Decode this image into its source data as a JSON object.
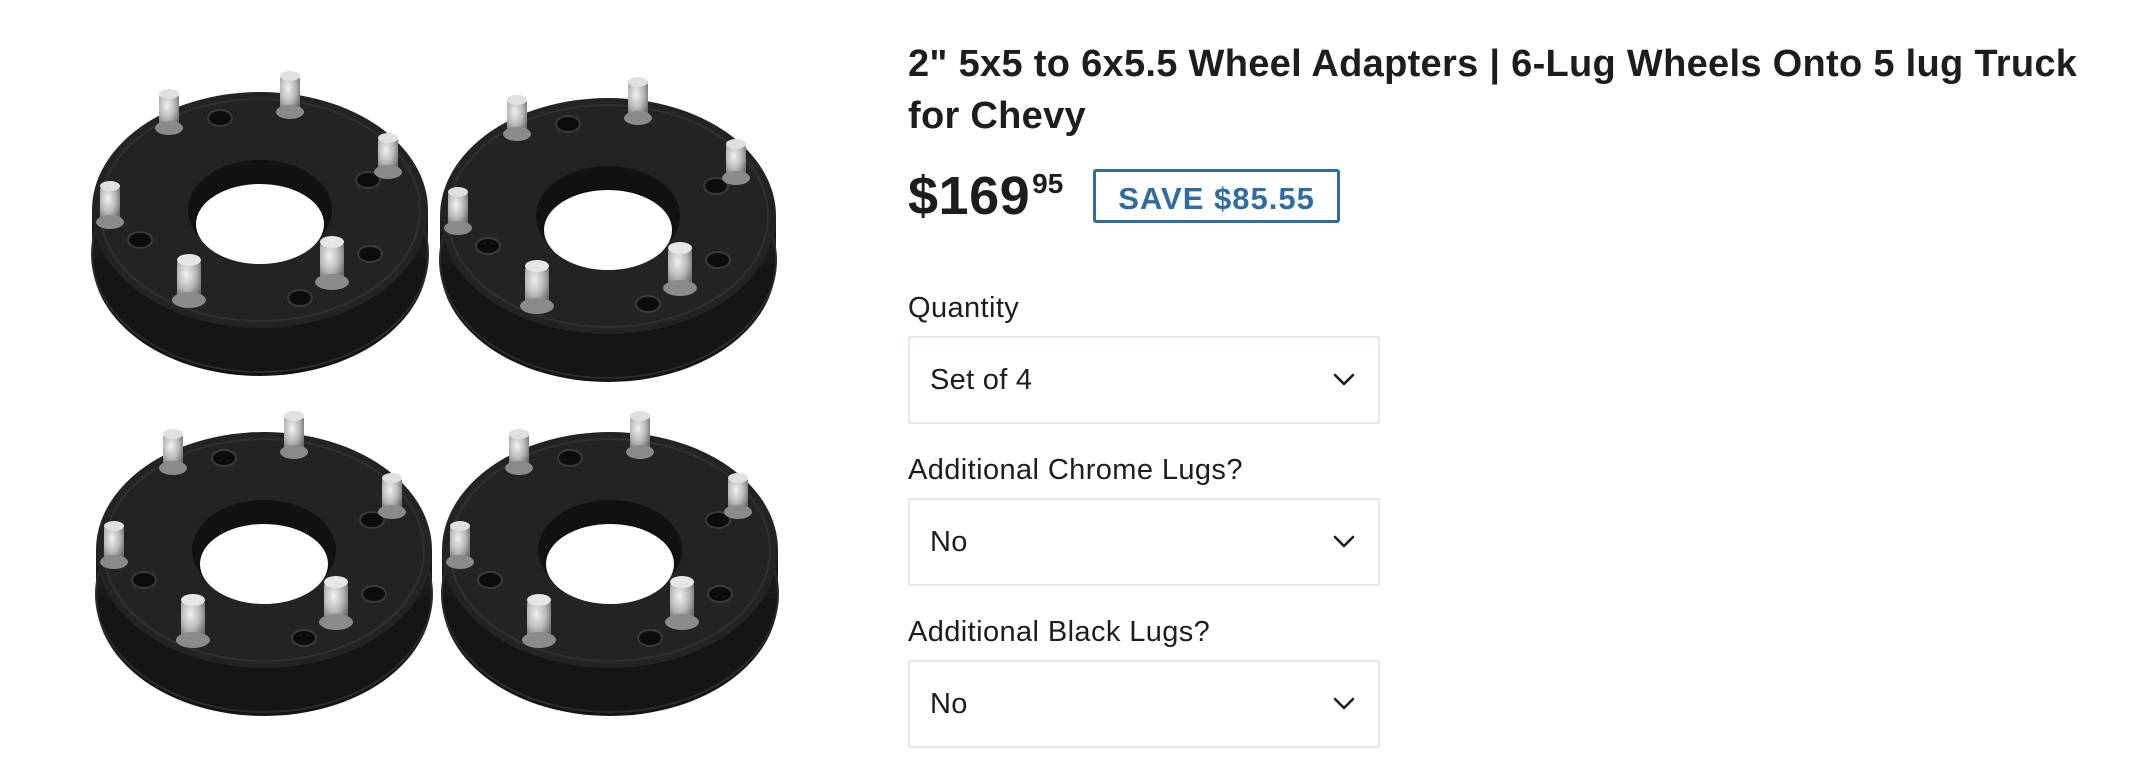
{
  "product": {
    "title": "2\" 5x5 to 6x5.5 Wheel Adapters | 6-Lug Wheels Onto 5 lug Truck for Chevy",
    "price_main": "$169",
    "price_cents": "95",
    "save_badge": "SAVE $85.55"
  },
  "options": [
    {
      "label": "Quantity",
      "value": "Set of 4"
    },
    {
      "label": "Additional Chrome Lugs?",
      "value": "No"
    },
    {
      "label": "Additional Black Lugs?",
      "value": "No"
    }
  ],
  "icons": {
    "dropdown": "chevron-down-icon"
  },
  "colors": {
    "accent": "#2e6da4",
    "text": "#1c1d1d",
    "border": "#e8e8e1"
  }
}
